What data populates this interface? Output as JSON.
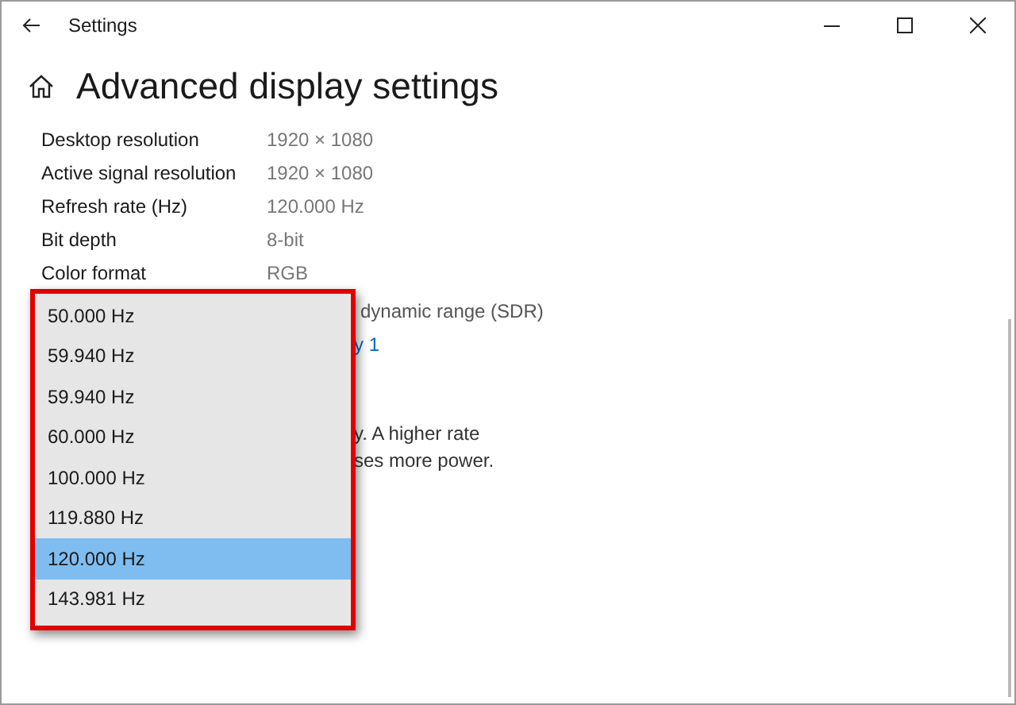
{
  "window": {
    "title": "Settings"
  },
  "page": {
    "title": "Advanced display settings"
  },
  "info_rows": [
    {
      "label": "Desktop resolution",
      "value": "1920 × 1080"
    },
    {
      "label": "Active signal resolution",
      "value": "1920 × 1080"
    },
    {
      "label": "Refresh rate (Hz)",
      "value": "120.000 Hz"
    },
    {
      "label": "Bit depth",
      "value": "8-bit"
    },
    {
      "label": "Color format",
      "value": "RGB"
    }
  ],
  "partial_texts": [
    {
      "kind": "text",
      "text": "dynamic range (SDR)"
    },
    {
      "kind": "link",
      "text": "y 1"
    }
  ],
  "partial_paragraph": [
    "y. A higher rate",
    "ses more power."
  ],
  "dropdown": {
    "options": [
      {
        "label": "50.000 Hz",
        "selected": false
      },
      {
        "label": "59.940 Hz",
        "selected": false
      },
      {
        "label": "59.940 Hz",
        "selected": false
      },
      {
        "label": "60.000 Hz",
        "selected": false
      },
      {
        "label": "100.000 Hz",
        "selected": false
      },
      {
        "label": "119.880 Hz",
        "selected": false
      },
      {
        "label": "120.000 Hz",
        "selected": true
      },
      {
        "label": "143.981 Hz",
        "selected": false
      }
    ]
  }
}
